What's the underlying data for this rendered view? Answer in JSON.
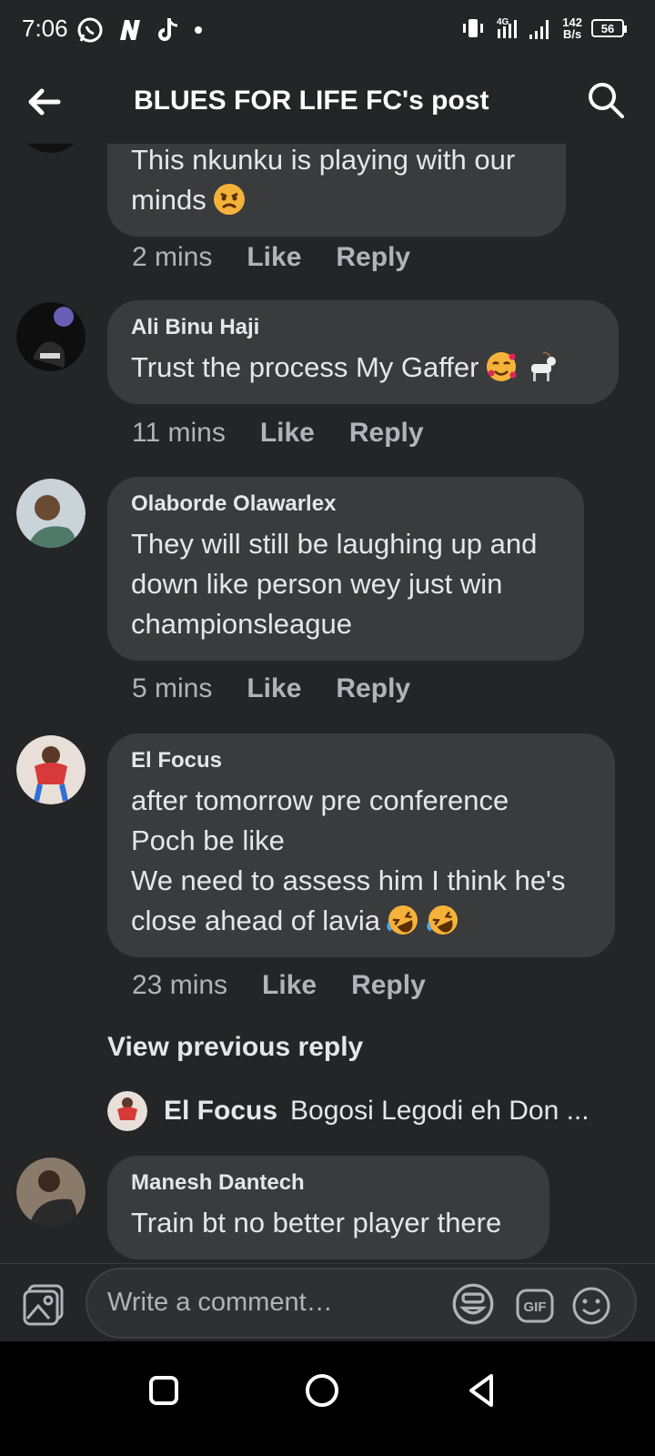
{
  "status_bar": {
    "time": "7:06",
    "net_speed_value": "142",
    "net_speed_unit": "B/s",
    "battery": "56",
    "network": "4G"
  },
  "header": {
    "title": "BLUES FOR LIFE FC's post"
  },
  "comments": [
    {
      "author": "",
      "text": "This nkunku is playing with our\nminds",
      "emojis": [
        "angry-face"
      ],
      "time": "2 mins",
      "like": "Like",
      "reply": "Reply"
    },
    {
      "author": "Ali Binu Haji",
      "text": "Trust the process My Gaffer",
      "emojis": [
        "smiling-face-with-hearts",
        "goat"
      ],
      "time": "11 mins",
      "like": "Like",
      "reply": "Reply"
    },
    {
      "author": "Olaborde Olawarlex",
      "text": "They will still be laughing up and\ndown like person wey just win\nchampionsleague",
      "emojis": [],
      "time": "5 mins",
      "like": "Like",
      "reply": "Reply"
    },
    {
      "author": "El Focus",
      "text": "after tomorrow pre conference\nPoch be like\nWe need to assess him I think he's\nclose ahead of lavia",
      "emojis": [
        "rolling-on-floor-laughing",
        "rolling-on-floor-laughing"
      ],
      "time": "23 mins",
      "like": "Like",
      "reply": "Reply"
    },
    {
      "author": "Manesh Dantech",
      "text": "Train bt no better player there",
      "emojis": []
    }
  ],
  "view_previous_reply": "View previous reply",
  "reply_preview": {
    "author": "El Focus",
    "text": "Bogosi Legodi eh Don ..."
  },
  "composer": {
    "placeholder": "Write a comment…",
    "icons": [
      "photo-icon",
      "sticker-icon",
      "gif-icon",
      "emoji-icon"
    ]
  },
  "nav_bar": {
    "icons": [
      "recent-apps-icon",
      "home-icon",
      "back-icon"
    ]
  },
  "colors": {
    "background": "#242527",
    "bubble": "#3a3b3c",
    "primary_text": "#e4e6eb",
    "secondary_text": "#b0b3b8"
  }
}
